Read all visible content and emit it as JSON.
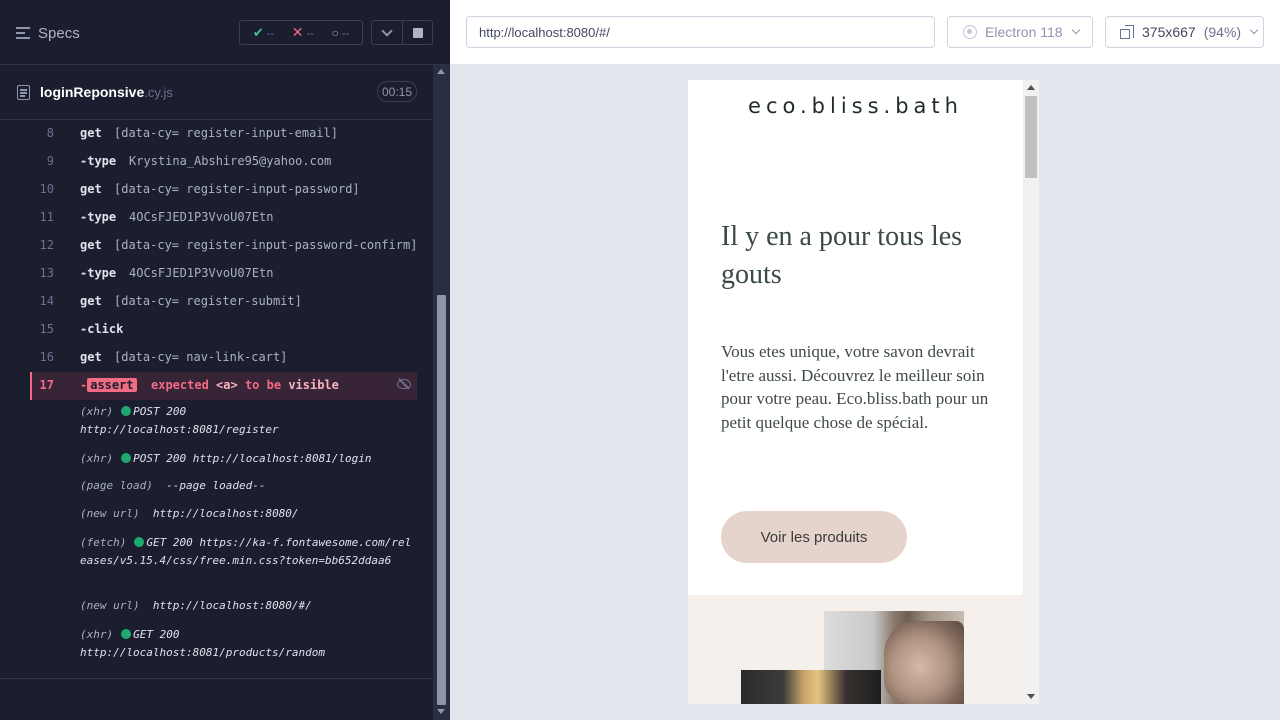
{
  "reporter": {
    "specs_label": "Specs",
    "stats": {
      "passed": "--",
      "failed": "--",
      "pending": "--"
    },
    "spec_file": {
      "name": "loginReponsive",
      "ext": ".cy.js",
      "duration": "00:15"
    },
    "commands": [
      {
        "num": "8",
        "name": "get",
        "msg": "[data-cy= register-input-email]"
      },
      {
        "num": "9",
        "name": "-type",
        "msg": "Krystina_Abshire95@yahoo.com"
      },
      {
        "num": "10",
        "name": "get",
        "msg": "[data-cy= register-input-password]"
      },
      {
        "num": "11",
        "name": "-type",
        "msg": "4OCsFJED1P3VvoU07Etn"
      },
      {
        "num": "12",
        "name": "get",
        "msg": "[data-cy= register-input-password-confirm]"
      },
      {
        "num": "13",
        "name": "-type",
        "msg": "4OCsFJED1P3VvoU07Etn"
      },
      {
        "num": "14",
        "name": "get",
        "msg": "[data-cy= register-submit]"
      },
      {
        "num": "15",
        "name": "-click",
        "msg": ""
      },
      {
        "num": "16",
        "name": "get",
        "msg": "[data-cy= nav-link-cart]"
      }
    ],
    "failed_command": {
      "num": "17",
      "prefix": "-",
      "name": "assert",
      "w1": "expected",
      "w2": "<a>",
      "w3": "to be",
      "w4": "visible"
    },
    "logs": [
      {
        "kind": "(xhr)",
        "method": "POST 200",
        "url": "http://localhost:8081/register",
        "dot": true
      },
      {
        "kind": "(xhr)",
        "method": "POST 200",
        "url": "http://localhost:8081/login",
        "dot": true
      },
      {
        "kind": "(page load)",
        "method": "",
        "url": "--page loaded--",
        "dot": false
      },
      {
        "kind": "(new url)",
        "method": "",
        "url": "http://localhost:8080/",
        "dot": false
      },
      {
        "kind": "(fetch)",
        "method": "GET 200",
        "url": "https://ka-f.fontawesome.com/releases/v5.15.4/css/free.min.css?token=bb652ddaa6",
        "dot": true
      },
      {
        "kind": "(new url)",
        "method": "",
        "url": "http://localhost:8080/#/",
        "dot": false
      },
      {
        "kind": "(xhr)",
        "method": "GET 200",
        "url": "http://localhost:8081/products/random",
        "dot": true
      }
    ]
  },
  "aut": {
    "url": "http://localhost:8080/#/",
    "browser": "Electron 118",
    "viewport": "375x667",
    "zoom": "(94%)"
  },
  "app": {
    "logo": "eco.bliss.bath",
    "hero_title": "Il y en a pour tous les gouts",
    "hero_text": "Vous etes unique, votre savon devrait l'etre aussi. Découvrez le meilleur soin pour votre peau. Eco.bliss.bath pour un petit quelque chose de spécial.",
    "cta": "Voir les produits"
  },
  "colors": {
    "reporter_bg": "#1b1e2e",
    "pass": "#3fc988",
    "fail": "#f26b85",
    "cta_bg": "#e5d4cc"
  }
}
